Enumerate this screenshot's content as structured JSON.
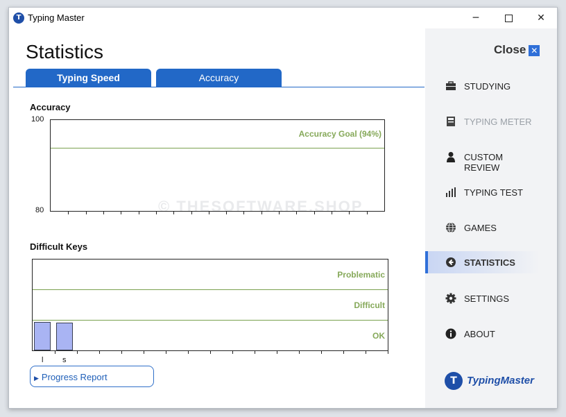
{
  "window": {
    "title": "Typing Master",
    "minimize_glyph": "─",
    "close_glyph": "✕"
  },
  "page": {
    "title": "Statistics"
  },
  "tabs": [
    {
      "label": "Typing Speed"
    },
    {
      "label": "Accuracy"
    }
  ],
  "accuracy_chart": {
    "title": "Accuracy",
    "y_top_label": "100",
    "y_bottom_label": "80",
    "goal_label": "Accuracy Goal (94%)"
  },
  "difficult_keys": {
    "title": "Difficult Keys",
    "bands": [
      "Problematic",
      "Difficult",
      "OK"
    ],
    "keys": [
      {
        "key": "l"
      },
      {
        "key": "s"
      }
    ]
  },
  "progress_report": {
    "label": "Progress Report"
  },
  "watermark": "© THESOFTWARE.SHOP",
  "sidebar": {
    "close_label": "Close",
    "items": [
      {
        "label": "STUDYING",
        "icon": "briefcase-icon"
      },
      {
        "label": "TYPING METER",
        "icon": "calculator-icon"
      },
      {
        "label": "CUSTOM REVIEW",
        "icon": "person-icon"
      },
      {
        "label": "TYPING TEST",
        "icon": "bar-chart-icon"
      },
      {
        "label": "GAMES",
        "icon": "globe-icon"
      },
      {
        "label": "STATISTICS",
        "icon": "back-arrow-icon"
      },
      {
        "label": "SETTINGS",
        "icon": "gear-icon"
      },
      {
        "label": "ABOUT",
        "icon": "info-icon"
      }
    ],
    "brand": "TypingMaster"
  },
  "colors": {
    "accent": "#2268c7",
    "goal_line": "#7aa14e",
    "bar_fill": "#a9b4f3",
    "active_nav": "#2f6fd8"
  },
  "chart_data": [
    {
      "type": "line",
      "title": "Accuracy",
      "ylim": [
        80,
        100
      ],
      "series": [],
      "annotations": [
        {
          "label": "Accuracy Goal (94%)",
          "y": 94
        }
      ]
    },
    {
      "type": "bar",
      "title": "Difficult Keys",
      "categories": [
        "l",
        "s"
      ],
      "bands": [
        "OK",
        "Difficult",
        "Problematic"
      ],
      "values": [
        0.95,
        0.92
      ],
      "ylim": [
        0,
        3
      ]
    }
  ]
}
